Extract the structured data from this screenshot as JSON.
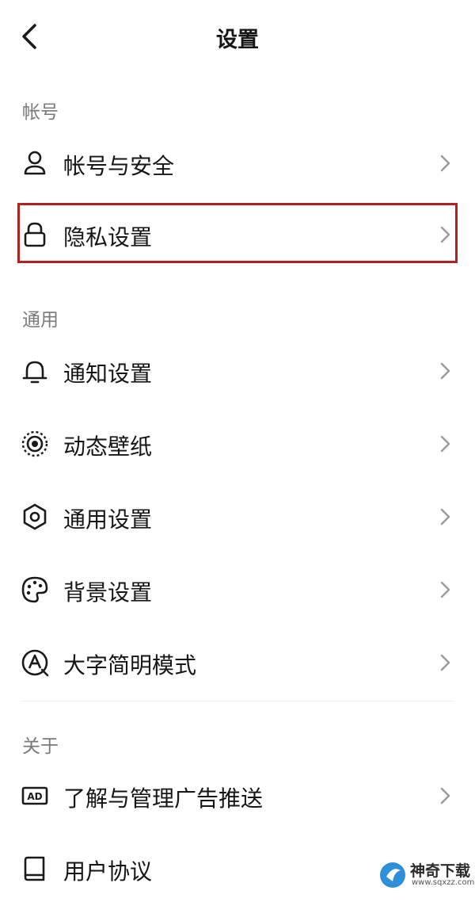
{
  "header": {
    "title": "设置",
    "back_icon": "chevron-left-icon"
  },
  "sections": {
    "account": {
      "title": "帐号",
      "items": [
        {
          "label": "帐号与安全",
          "icon": "user-icon"
        },
        {
          "label": "隐私设置",
          "icon": "lock-icon",
          "highlighted": true
        }
      ]
    },
    "general": {
      "title": "通用",
      "items": [
        {
          "label": "通知设置",
          "icon": "bell-icon"
        },
        {
          "label": "动态壁纸",
          "icon": "dynamic-wallpaper-icon"
        },
        {
          "label": "通用设置",
          "icon": "gear-icon"
        },
        {
          "label": "背景设置",
          "icon": "palette-icon"
        },
        {
          "label": "大字简明模式",
          "icon": "large-text-icon"
        }
      ]
    },
    "about": {
      "title": "关于",
      "items": [
        {
          "label": "了解与管理广告推送",
          "icon": "ad-icon"
        },
        {
          "label": "用户协议",
          "icon": "book-icon"
        }
      ]
    }
  },
  "watermark": {
    "name": "神奇下载",
    "url": "www.sqxzz.com"
  },
  "colors": {
    "highlight_border": "#b3201f",
    "section_label": "#7a7a7a",
    "text": "#161616",
    "chevron": "#9a9a9a"
  }
}
